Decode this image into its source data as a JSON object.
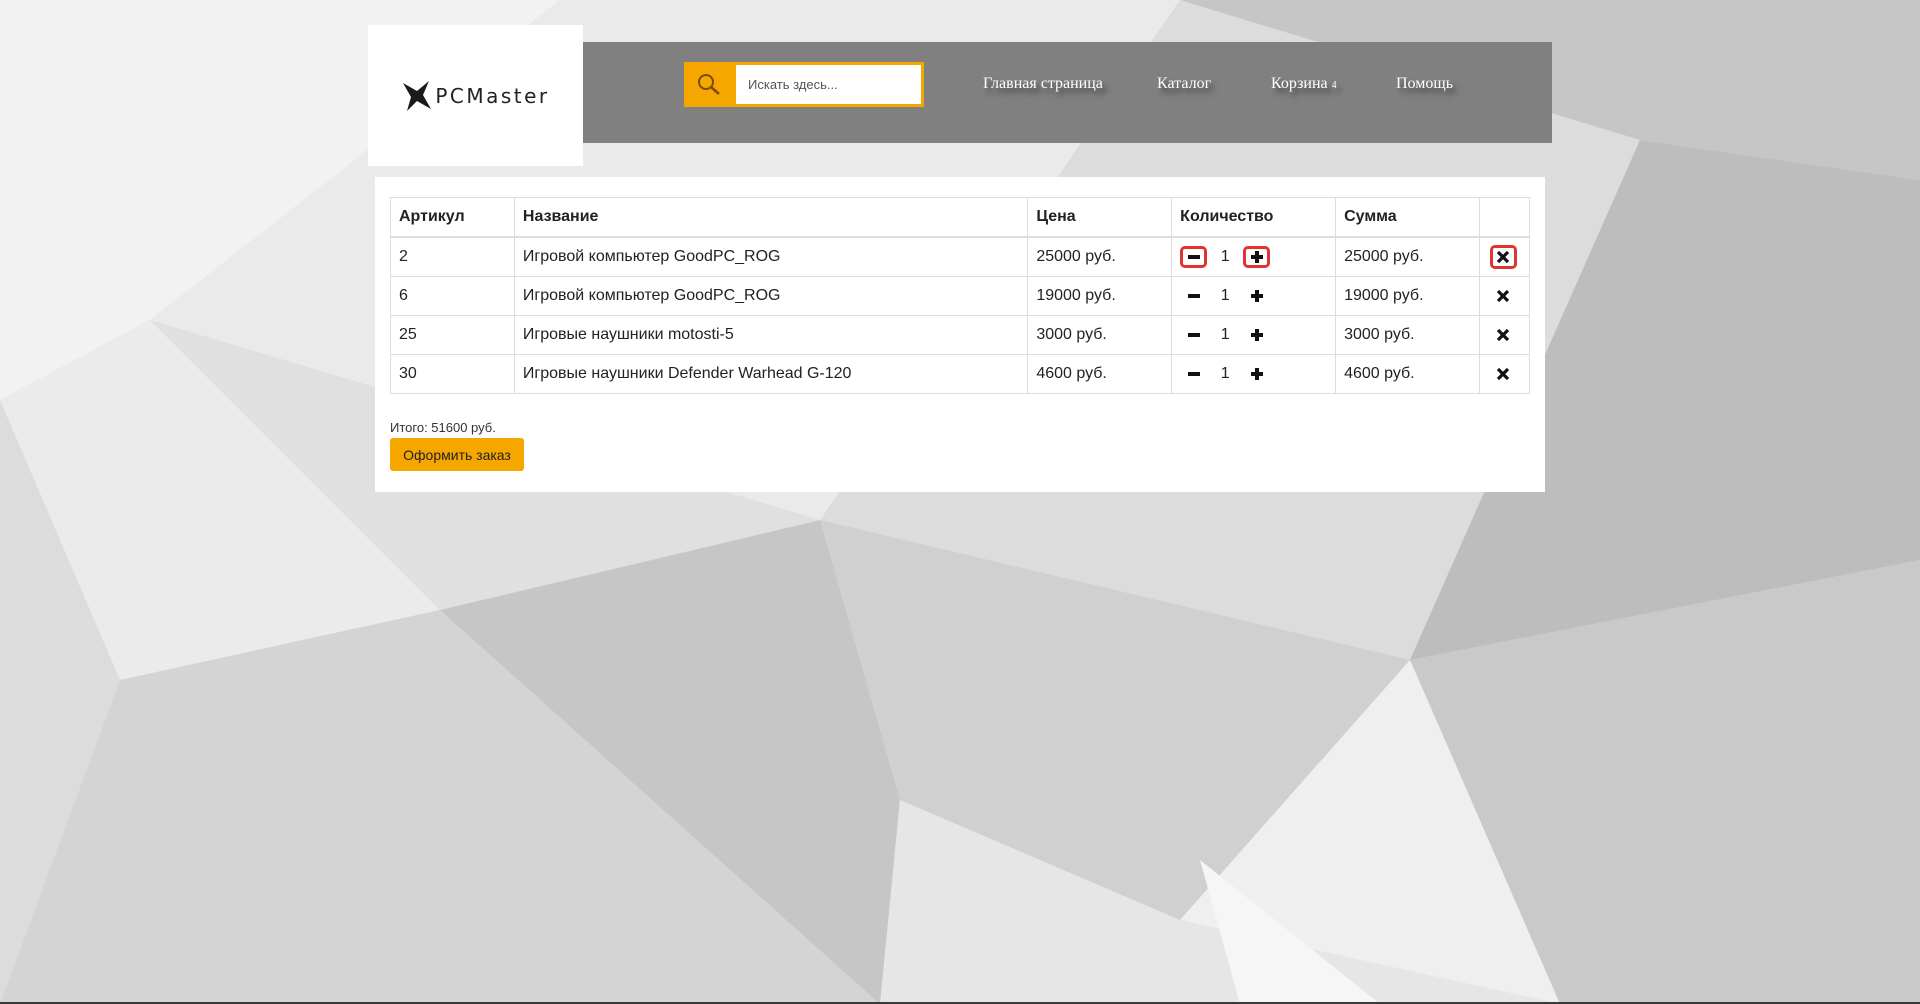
{
  "logo": {
    "text": "PCMaster"
  },
  "search": {
    "placeholder": "Искать здесь...",
    "icon": "search-icon"
  },
  "nav": {
    "items": [
      {
        "label": "Главная страница"
      },
      {
        "label": "Каталог"
      },
      {
        "label": "Корзина",
        "badge": "4"
      },
      {
        "label": "Помощь"
      }
    ]
  },
  "cart": {
    "headers": {
      "sku": "Артикул",
      "name": "Название",
      "price": "Цена",
      "qty": "Количество",
      "sum": "Сумма"
    },
    "rows": [
      {
        "sku": "2",
        "name": "Игровой компьютер GoodPC_ROG",
        "price": "25000 руб.",
        "qty": "1",
        "sum": "25000 руб."
      },
      {
        "sku": "6",
        "name": "Игровой компьютер GoodPC_ROG",
        "price": "19000 руб.",
        "qty": "1",
        "sum": "19000 руб."
      },
      {
        "sku": "25",
        "name": "Игровые наушники motosti-5",
        "price": "3000 руб.",
        "qty": "1",
        "sum": "3000 руб."
      },
      {
        "sku": "30",
        "name": "Игровые наушники Defender Warhead G-120",
        "price": "4600 руб.",
        "qty": "1",
        "sum": "4600 руб."
      }
    ],
    "total": "Итого: 51600 руб.",
    "order_button": "Оформить заказ"
  },
  "colors": {
    "accent": "#f5a700",
    "nav_bg": "#808080",
    "highlight": "#e03434"
  }
}
